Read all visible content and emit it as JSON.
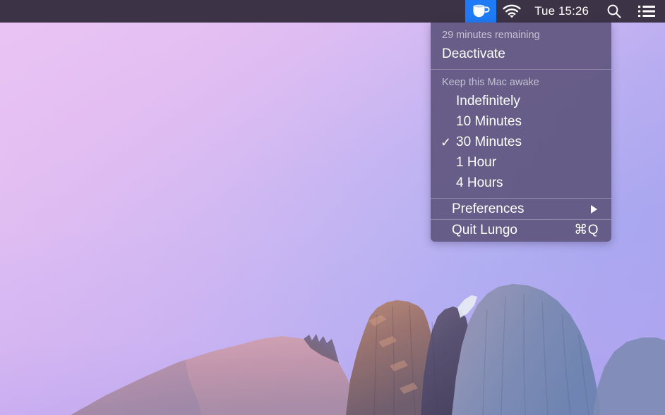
{
  "menubar": {
    "app_icon": "coffee-cup-icon",
    "wifi_icon": "wifi-icon",
    "clock": "Tue 15:26",
    "spotlight_icon": "search-icon",
    "notification_icon": "list-icon",
    "accent_highlight": "#1e7bf5",
    "bar_background": "#3d3347"
  },
  "menu": {
    "status": {
      "remaining": "29 minutes remaining",
      "action": "Deactivate"
    },
    "awake": {
      "caption": "Keep this Mac awake",
      "options": [
        {
          "label": "Indefinitely",
          "checked": false
        },
        {
          "label": "10 Minutes",
          "checked": false
        },
        {
          "label": "30 Minutes",
          "checked": true
        },
        {
          "label": "1 Hour",
          "checked": false
        },
        {
          "label": "4 Hours",
          "checked": false
        }
      ],
      "check_glyph": "✓"
    },
    "preferences": {
      "label": "Preferences",
      "submenu_indicator": "▶"
    },
    "quit": {
      "label": "Quit Lungo",
      "shortcut": "⌘Q"
    },
    "background": "#605680"
  },
  "desktop": {
    "wallpaper_name": "Yosemite Half Dome",
    "gradient_left": "#e9c6f2",
    "gradient_right": "#a6a3ee"
  }
}
